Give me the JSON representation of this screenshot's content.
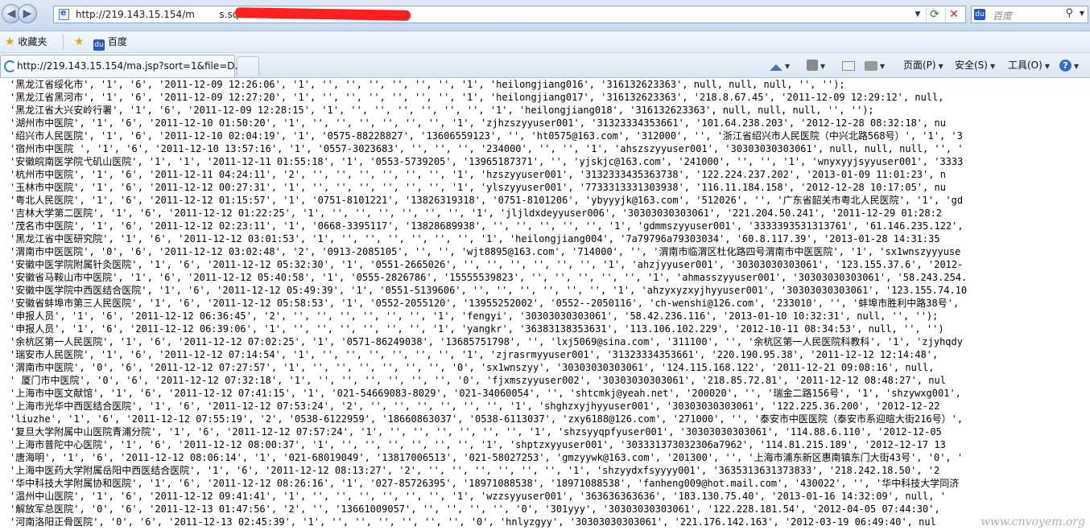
{
  "address_bar": {
    "url": "http://219.143.15.154/m        s.sql",
    "search_placeholder": "百度"
  },
  "favorites_bar": {
    "favorites_label": "收藏夹",
    "baidu_label": "百度"
  },
  "tab": {
    "title": "http://219.143.15.154/ma.jsp?sort=1&file=D..."
  },
  "commands": {
    "page": "页面(P)",
    "safety": "安全(S)",
    "tools": "工具(O)"
  },
  "content_lines": [
    "'黑龙江省绥化市', '1', '6', '2011-12-09 12:26:06', '1', '', '', '', '', '', '', '1', 'heilongjiang016', '316132623363', null, null, null, '', '');",
    "'黑龙江省黑河市', '1', '6', '2011-12-09 12:27:20', '1', '', '', '', '', '', '', '1', 'heilongjiang017', '316132623363', '218.8.67.45', '2011-12-09 12:29:12', null,",
    "'黑龙江省大兴安岭行署', '1', '6', '2011-12-09 12:28:15', '1', '', '', '', '', '', '', '1', 'heilongjiang018', '316132623363', null, null, null, '', '');",
    "'湖州市中医院', '1', '6', '2011-12-10 01:50:20', '1', '', '', '', '', '', '', '1', 'zjhzszyyuser001', '31323334353661', '101.64.238.203', '2012-12-28 08:32:18', nu",
    "'绍兴市人民医院', '1', '6', '2011-12-10 02:04:19', '1', '0575-88228827', '13606559123', '', 'ht0575@163.com', '312000', '', '浙江省绍兴市人民医院（中兴北路568号）', '1', '3",
    "'宿州市中医院 ', '1', '6', '2011-12-10 13:57:16', '1', '0557-3023683', '', '', '', '234000', '', '', '1', 'ahszszyyuser001', '30303030303061', null, null, null, '', '",
    "'安徽皖南医学院弋矶山医院', '1', '1', '2011-12-11 01:55:18', '1', '0553-5739205', '13965187371', '', 'yjskjc@163.com', '241000', '', '', '1', 'wnyxyyjsyyuser001', '3333",
    "'杭州市中医院', '1', '6', '2011-12-11 04:24:11', '2', '', '', '', '', '', '', '1', 'hzszyyuser001', '3132333435363738', '122.224.237.202', '2013-01-09 11:01:23', n",
    "'玉林市中医院', '1', '6', '2011-12-12 00:27:31', '1', '', '', '', '', '', '', '1', 'ylszyyuser001', '7733313331303938', '116.11.184.158', '2012-12-28 10:17:05', nu",
    "'粤北人民医院', '1', '6', '2011-12-12 01:15:57', '1', '0751-8101221', '13826319318', '0751-8101206', 'ybyyyjk@163.com', '512026', '', '广东省韶关市粤北人民医院', '1', 'gd",
    "'吉林大学第二医院', '1', '6', '2011-12-12 01:22:25', '1', '', '', '', '', '', '', '1', 'jljldxdeyyuser006', '30303030303061', '221.204.50.241', '2011-12-29 01:28:2",
    "'茂名市中医院', '1', '6', '2011-12-12 02:23:11', '1', '0668-3395117', '13828689938', '', '', '', '', '', '1', 'gdmmszyyuser001', '3333393531313761', '61.146.235.122',",
    "'黑龙江省中医研究院', '1', '6', '2011-12-12 03:01:53', '1', '', '', '', '', '', '', '1', 'heilongjiang004', '7a79796a79303034', '60.8.117.39', '2013-01-28 14:31:35",
    "'渭南市中医医院', '0', '6', '2011-12-12 03:02:48', '2', '0913-2085105', '', '', 'wjt8895@163.com', '714000', '', '渭南市临渭区杜化路四号渭南市中医医院', '1', 'sx1wnszyyyuse",
    "'安徽中医学院附属针灸医院', '1', '6', '2011-12-12 05:32:30', '1', '0551-2665026', '', '', '', '', '', '', '1', 'ahzjyyuser001', '30303030303061', '123.155.37.6', '2012-",
    "'安徽省马鞍山市中医院', '1', '6', '2011-12-12 05:40:58', '1', '0555-2826786', '15555539823', '', '', '', '', '', '1', 'ahmasszyyuser001', '30303030303061', '58.243.254.",
    "'安徽中医学院中西医结合医院', '1', '6', '2011-12-12 05:49:39', '1', '0551-5139606', '', '', '', '', '', '', '1', 'ahzyxyzxyjhyyuser001', '30303030303061', '123.155.74.10",
    "'安徽省蚌埠市第三人民医院', '1', '6', '2011-12-12 05:58:53', '1', '0552-2055120', '13955252002', '0552--2050116', 'ch-wenshi@126.com', '233010', '', '蚌埠市胜利中路38号',",
    "'申报人员', '1', '6', '2011-12-12 06:36:45', '2', '', '', '', '', '', '', '1', 'fengyi', '30303030303061', '58.42.236.116', '2013-01-10 10:32:31', null, '', '');",
    "'申报人员', '1', '6', '2011-12-12 06:39:06', '1', '', '', '', '', '', '', '1', 'yangkr', '36383138353631', '113.106.102.229', '2012-10-11 08:34:53', null, '', '')",
    "'余杭区第一人民医院', '1', '6', '2011-12-12 07:02:25', '1', '0571-86249038', '13685751798', '', 'lxj5069@sina.com', '311100', '', '余杭区第一人民医院科教科', '1', 'zjyhqdy",
    "'瑞安市人民医院', '1', '6', '2011-12-12 07:14:54', '1', '', '', '', '', '', '', '1', 'zjrasrmyyuser001', '31323334353661', '220.190.95.38', '2011-12-12 12:14:48',",
    "'渭南市中医院', '0', '6', '2011-12-12 07:27:57', '1', '', '', '', '', '', '', '0', 'sx1wnszyy', '30303030303061', '124.115.168.122', '2011-12-21 09:08:16', null,",
    "' 厦门市中医院', '0', '6', '2011-12-12 07:32:18', '1', '', '', '', '', '', '', '0', 'fjxmszyyuser002', '30303030303061', '218.85.72.81', '2011-12-12 08:48:27', nul",
    "'上海市中医文献馆', '1', '6', '2011-12-12 07:41:15', '1', '021-54669083-8029', '021-34060054', '', 'shtcmkj@yeah.net', '200020', '', '瑞金二路156号', '1', 'shzywxg001',",
    "'上海市光华中西医结合医院', '1', '6', '2011-12-12 07:53:24', '2', '', '', '', '', '', '', '1', 'shghzxyjhyyuser001', '30303030303061', '122.225.36.200', '2012-12-22",
    "'liuzhe', '1', '6', '2011-12-12 07:55:19', '2', '0538-6122959', '18660863037', '0538-6113037', 'zxy6188@126.com', '271000', '', '泰安市中医医院（泰安市系迎暄大街216号）',",
    "'复旦大学附属中山医院青浦分院', '1', '6', '2011-12-12 07:57:24', '1', '', '', '', '', '', '', '1', 'shzsyyqpfyuser001', '30303030303061', '114.88.6.110', '2012-12-05",
    "'上海市普陀中心医院', '1', '6', '2011-12-12 08:00:37', '1', '', '', '', '', '', '', '1', 'shptzxyyuser001', '303331373032306a7962', '114.81.215.189', '2012-12-17 13",
    "'唐海明', '1', '6', '2011-12-12 08:06:14', '1', '021-68019049', '13817006513', '021-58027253', 'gmzyywk@163.com', '201300', '', '上海市浦东新区惠南镇东门大街43号', '0', '",
    "'上海中医药大学附属岳阳中西医结合医院', '1', '6', '2011-12-12 08:13:27', '2', '', '', '', '', '', '', '1', 'shzyydxfsyyyy001', '3635313631373833', '218.242.18.50', '2",
    "'华中科技大学附属协和医院', '1', '6', '2011-12-12 08:26:16', '1', '027-85726395', '18971088538', '18971088538', 'fanheng009@hot.mail.com', '430022', '', '华中科技大学同济",
    "'温州中山医院', '1', '6', '2011-12-12 09:41:41', '1', '', '', '', '', '', '', '1', 'wzzsyyuser001', '363636363636', '183.130.75.40', '2013-01-16 14:32:09', null, '",
    "'解放军总医院', '0', '6', '2011-12-13 01:47:56', '2', '', '13661009057', '', '', '', '', '0', '301yyy', '30303030303061', '122.228.181.54', '2012-04-05 07:44:30',",
    "'河南洛阳正骨医院', '0', '6', '2011-12-13 02:45:39', '1', '', '', '', '', '', '', '0', 'hnlyzgyy', '30303030303061', '221.176.142.163', '2012-03-19 06:49:40', nul"
  ],
  "watermark": "www.cnvoyem.org"
}
